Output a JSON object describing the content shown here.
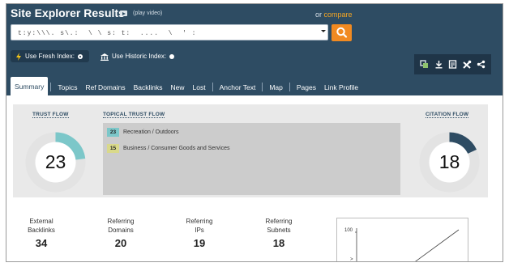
{
  "header": {
    "title": "Site Explorer Results",
    "video_icon": "video-icon",
    "play_video": "(play video)",
    "or_text": "or",
    "compare_link": "compare",
    "search": {
      "value": "t:y:\\\\\\. s\\.:  \\ \\ s: t:  ....  \\  ' :",
      "search_button_icon": "magnifier-icon"
    },
    "index_options": {
      "fresh_label": "Use Fresh Index:",
      "historic_label": "Use Historic Index:",
      "selected": "fresh"
    },
    "toolbar_icons": [
      "copy-icon",
      "download-icon",
      "report-icon",
      "tools-icon",
      "share-icon"
    ]
  },
  "tabs": [
    {
      "label": "Summary",
      "active": true
    },
    {
      "label": "Topics"
    },
    {
      "label": "Ref Domains"
    },
    {
      "label": "Backlinks"
    },
    {
      "label": "New"
    },
    {
      "label": "Lost"
    },
    {
      "label": "Anchor Text"
    },
    {
      "label": "Map"
    },
    {
      "label": "Pages"
    },
    {
      "label": "Link Profile"
    }
  ],
  "metrics": {
    "trust_flow": {
      "label": "TRUST FLOW",
      "value": "23",
      "fill_percent": 23,
      "color": "#7cc7c9"
    },
    "topical_trust_flow": {
      "label": "TOPICAL TRUST FLOW",
      "topics": [
        {
          "score": "23",
          "name": "Recreation / Outdoors",
          "color": "#7cc7c9"
        },
        {
          "score": "15",
          "name": "Business / Consumer Goods and Services",
          "color": "#d9d98a"
        }
      ]
    },
    "citation_flow": {
      "label": "CITATION FLOW",
      "value": "18",
      "fill_percent": 18,
      "color": "#2e4c63"
    }
  },
  "stats": [
    {
      "label": [
        "External",
        "Backlinks"
      ],
      "value": "34"
    },
    {
      "label": [
        "Referring",
        "Domains"
      ],
      "value": "20"
    },
    {
      "label": [
        "Referring",
        "IPs"
      ],
      "value": "19"
    },
    {
      "label": [
        "Referring",
        "Subnets"
      ],
      "value": "18"
    }
  ],
  "mini_chart": {
    "tick_top": "100",
    "tick_mid": ">"
  },
  "colors": {
    "header_bg": "#2e4c63",
    "accent_orange": "#f18a21",
    "gauge_track": "#e3e3e3"
  }
}
